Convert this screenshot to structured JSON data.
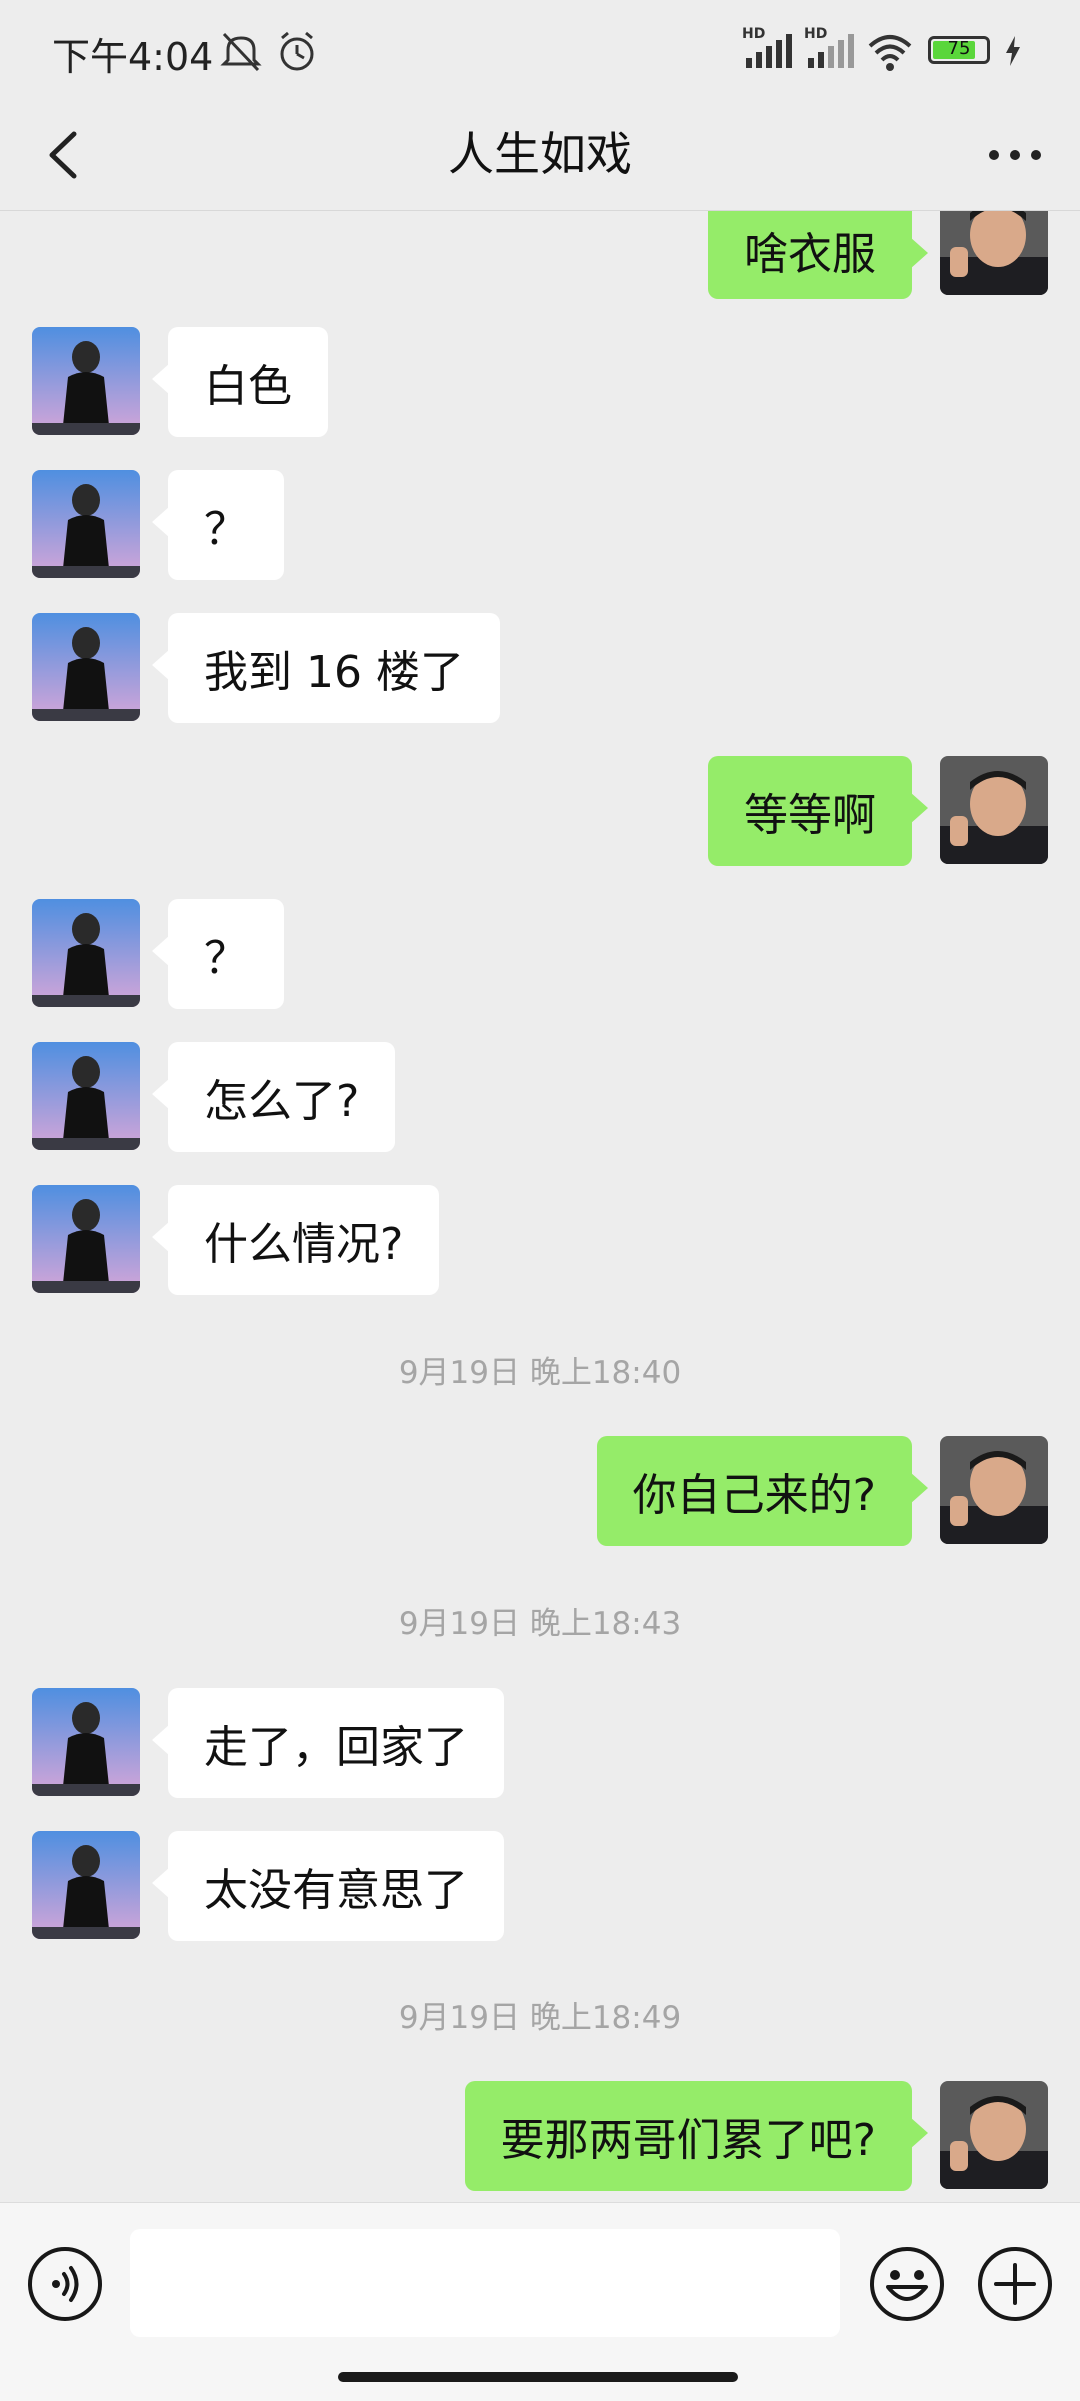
{
  "status_bar": {
    "time": "下午4:04",
    "battery": "75",
    "signal_label": "HD"
  },
  "header": {
    "title": "人生如戏"
  },
  "chat": {
    "messages": [
      {
        "side": "right",
        "text": "啥衣服"
      },
      {
        "side": "left",
        "text": "白色"
      },
      {
        "side": "left",
        "text": "？"
      },
      {
        "side": "left",
        "text": "我到 16 楼了"
      },
      {
        "side": "right",
        "text": "等等啊"
      },
      {
        "side": "left",
        "text": "？"
      },
      {
        "side": "left",
        "text": "怎么了?"
      },
      {
        "side": "left",
        "text": "什么情况?"
      },
      {
        "side": "right",
        "text": "你自己来的?"
      },
      {
        "side": "left",
        "text": "走了，回家了"
      },
      {
        "side": "left",
        "text": "太没有意思了"
      },
      {
        "side": "right",
        "text": "要那两哥们累了吧?"
      }
    ],
    "timestamps": [
      "9月19日 晚上18:40",
      "9月19日 晚上18:43",
      "9月19日 晚上18:49"
    ]
  },
  "input_bar": {
    "value": ""
  },
  "colors": {
    "background": "#ededed",
    "sent_bubble": "#95ec69",
    "received_bubble": "#ffffff",
    "battery_green": "#5ad63b"
  }
}
